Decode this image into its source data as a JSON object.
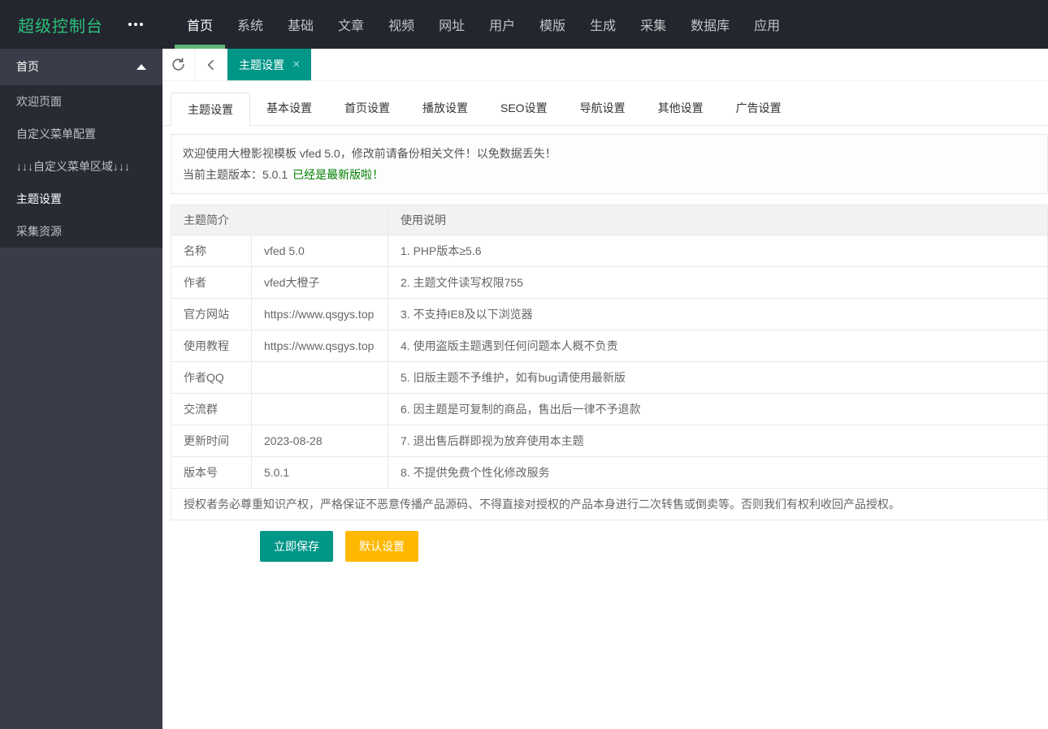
{
  "colors": {
    "header_bg": "#23262E",
    "sidebar_bg": "#393D49",
    "sidebar_submenu_bg": "#282B33",
    "logo_green": "#2BC17B",
    "nav_underline_green": "#5FB878",
    "accent_teal": "#009688",
    "warn_yellow": "#FFB800",
    "version_link_green": "#008000"
  },
  "header": {
    "logo": "超级控制台",
    "more_icon": "more-dots-icon",
    "nav": [
      {
        "label": "首页",
        "active": true
      },
      {
        "label": "系统",
        "active": false
      },
      {
        "label": "基础",
        "active": false
      },
      {
        "label": "文章",
        "active": false
      },
      {
        "label": "视频",
        "active": false
      },
      {
        "label": "网址",
        "active": false
      },
      {
        "label": "用户",
        "active": false
      },
      {
        "label": "模版",
        "active": false
      },
      {
        "label": "生成",
        "active": false
      },
      {
        "label": "采集",
        "active": false
      },
      {
        "label": "数据库",
        "active": false
      },
      {
        "label": "应用",
        "active": false
      }
    ]
  },
  "sidebar": {
    "group": {
      "label": "首页",
      "expanded": true,
      "arrow_icon": "triangle-up-icon"
    },
    "items": [
      {
        "label": "欢迎页面",
        "active": false
      },
      {
        "label": "自定义菜单配置",
        "active": false
      },
      {
        "label": "↓↓↓自定义菜单区域↓↓↓",
        "active": false
      },
      {
        "label": "主题设置",
        "active": true
      },
      {
        "label": "采集资源",
        "active": false
      }
    ]
  },
  "tabbar": {
    "refresh_icon": "refresh-icon",
    "back_icon": "chevron-left-icon",
    "tabs": [
      {
        "label": "主题设置",
        "active": true,
        "close_icon": "×"
      }
    ]
  },
  "subtabs": [
    {
      "label": "主题设置",
      "active": true
    },
    {
      "label": "基本设置",
      "active": false
    },
    {
      "label": "首页设置",
      "active": false
    },
    {
      "label": "播放设置",
      "active": false
    },
    {
      "label": "SEO设置",
      "active": false
    },
    {
      "label": "导航设置",
      "active": false
    },
    {
      "label": "其他设置",
      "active": false
    },
    {
      "label": "广告设置",
      "active": false
    }
  ],
  "notice": {
    "line1": "欢迎使用大橙影视模板 vfed 5.0，修改前请备份相关文件！以免数据丢失！",
    "line2_prefix": "当前主题版本：5.0.1",
    "line2_link": "已经是最新版啦！"
  },
  "info_table": {
    "col1_header": "主题简介",
    "col2_header": "使用说明",
    "rows": [
      {
        "label": "名称",
        "value": "vfed 5.0",
        "note": "1. PHP版本≥5.6"
      },
      {
        "label": "作者",
        "value": "vfed大橙子",
        "note": "2. 主题文件读写权限755"
      },
      {
        "label": "官方网站",
        "value": "https://www.qsgys.top",
        "note": "3. 不支持IE8及以下浏览器"
      },
      {
        "label": "使用教程",
        "value": "https://www.qsgys.top",
        "note": "4. 使用盗版主题遇到任何问题本人概不负责"
      },
      {
        "label": "作者QQ",
        "value": "",
        "note": "5. 旧版主题不予维护，如有bug请使用最新版"
      },
      {
        "label": "交流群",
        "value": "",
        "note": "6. 因主题是可复制的商品，售出后一律不予退款"
      },
      {
        "label": "更新时间",
        "value": "2023-08-28",
        "note": "7. 退出售后群即视为放弃使用本主题"
      },
      {
        "label": "版本号",
        "value": "5.0.1",
        "note": "8. 不提供免费个性化修改服务"
      }
    ],
    "disclaimer": "授权者务必尊重知识产权，严格保证不恶意传播产品源码、不得直接对授权的产品本身进行二次转售或倒卖等。否则我们有权利收回产品授权。"
  },
  "actions": {
    "save_label": "立即保存",
    "default_label": "默认设置"
  }
}
